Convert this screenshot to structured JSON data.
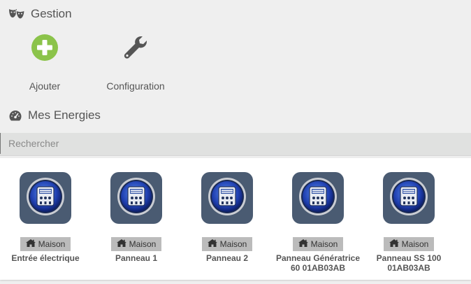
{
  "gestion": {
    "title": "Gestion",
    "icon": "mask-icon",
    "actions": [
      {
        "label": "Ajouter",
        "icon": "plus-circle-icon",
        "color": "#8bc34a"
      },
      {
        "label": "Configuration",
        "icon": "wrench-icon",
        "color": "#555555"
      }
    ]
  },
  "energies": {
    "title": "Mes Energies",
    "icon": "dashboard-icon"
  },
  "search": {
    "placeholder": "Rechercher",
    "value": ""
  },
  "equipment": [
    {
      "badge": "Maison",
      "name": "Entrée électrique"
    },
    {
      "badge": "Maison",
      "name": "Panneau 1"
    },
    {
      "badge": "Maison",
      "name": "Panneau 2"
    },
    {
      "badge": "Maison",
      "name": "Panneau Génératrice 60 01AB03AB"
    },
    {
      "badge": "Maison",
      "name": "Panneau SS 100 01AB03AB"
    }
  ],
  "colors": {
    "tile": "#4a5b72",
    "badge": "#bbbbbb",
    "accent_green": "#8bc34a"
  }
}
